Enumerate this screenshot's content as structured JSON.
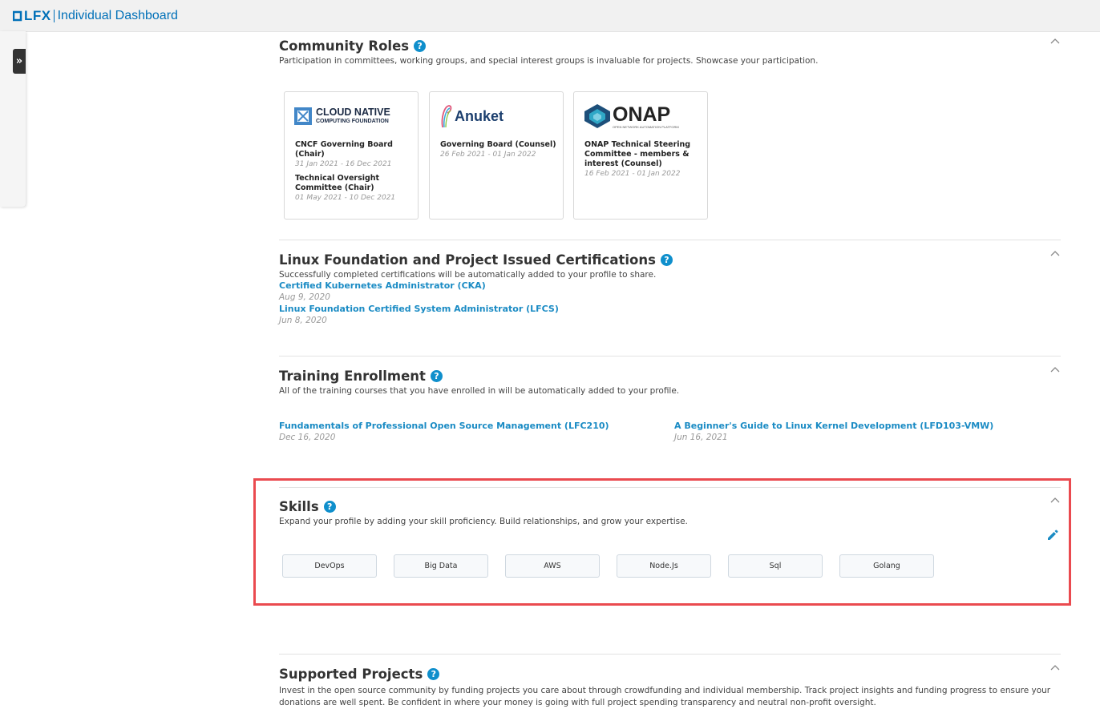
{
  "header": {
    "logo_text": "LFX",
    "app_title": "Individual Dashboard",
    "brand_color": "#0070b8"
  },
  "sidebar": {
    "expand_icon": "»"
  },
  "community_roles": {
    "title": "Community Roles",
    "description": "Participation in committees, working groups, and special interest groups is invaluable for projects. Showcase your participation.",
    "cards": [
      {
        "logo_text": "CLOUD NATIVE",
        "logo_subtext": "COMPUTING FOUNDATION",
        "roles": [
          {
            "name": "CNCF Governing Board (Chair)",
            "dates": "31 Jan 2021 - 16 Dec 2021"
          },
          {
            "name": "Technical Oversight Committee (Chair)",
            "dates": "01 May 2021 - 10 Dec 2021"
          }
        ]
      },
      {
        "logo_text": "Anuket",
        "roles": [
          {
            "name": "Governing Board (Counsel)",
            "dates": "26 Feb 2021 - 01 Jan 2022"
          }
        ]
      },
      {
        "logo_text": "ONAP",
        "logo_subtext": "OPEN NETWORK AUTOMATION PLATFORM",
        "roles": [
          {
            "name": "ONAP Technical Steering Committee - members & interest (Counsel)",
            "dates": "16 Feb 2021 - 01 Jan 2022"
          }
        ]
      }
    ]
  },
  "certifications": {
    "title": "Linux Foundation and Project Issued Certifications",
    "description": "Successfully completed certifications will be automatically added to your profile to share.",
    "items": [
      {
        "name": "Certified Kubernetes Administrator (CKA)",
        "date": "Aug 9, 2020"
      },
      {
        "name": "Linux Foundation Certified System Administrator (LFCS)",
        "date": "Jun 8, 2020"
      }
    ]
  },
  "training": {
    "title": "Training Enrollment",
    "description": "All of the training courses that you have enrolled in will be automatically added to your profile.",
    "items": [
      {
        "name": "Fundamentals of Professional Open Source Management (LFC210)",
        "date": "Dec 16, 2020"
      },
      {
        "name": "A Beginner's Guide to Linux Kernel Development (LFD103-VMW)",
        "date": "Jun 16, 2021"
      }
    ]
  },
  "skills": {
    "title": "Skills",
    "description": "Expand your profile by adding your skill proficiency. Build relationships, and grow your expertise.",
    "items": [
      "DevOps",
      "Big Data",
      "AWS",
      "Node.Js",
      "Sql",
      "Golang"
    ],
    "highlight_color": "#ea4a4f"
  },
  "supported_projects": {
    "title": "Supported Projects",
    "description_line1": "Invest in the open source community by funding projects you care about through crowdfunding and individual membership. Track project insights and funding progress to ensure your",
    "description_line2": "donations are well spent. Be confident in where your money is going with full project spending transparency and neutral non-profit oversight."
  },
  "help_icon": "?",
  "link_color": "#1a8bc4"
}
